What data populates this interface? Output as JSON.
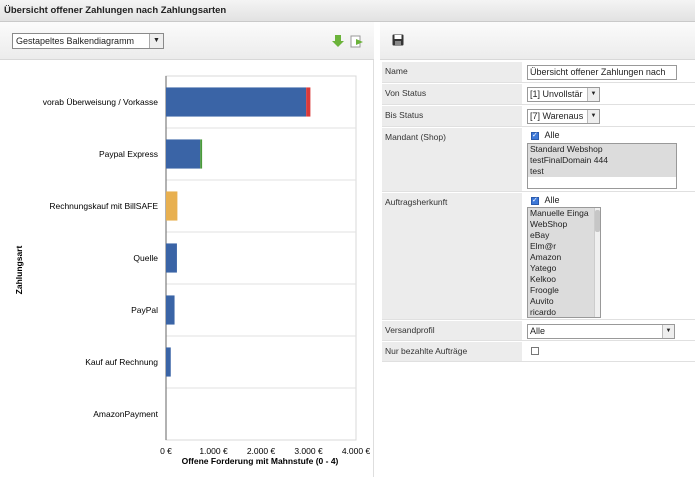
{
  "window": {
    "title": "Übersicht offener Zahlungen nach Zahlungsarten"
  },
  "toolbar": {
    "chart_type_value": "Gestapeltes Balkendiagramm",
    "icons": [
      "download-icon",
      "export-icon",
      "save-icon"
    ]
  },
  "chart_data": {
    "type": "bar",
    "orientation": "horizontal",
    "stacked": true,
    "categories": [
      "vorab Überweisung / Vorkasse",
      "Paypal Express",
      "Rechnungskauf mit BillSAFE",
      "Quelle",
      "PayPal",
      "Kauf auf Rechnung",
      "AmazonPayment"
    ],
    "series": [
      {
        "color": "#3a64a6",
        "values": [
          2950,
          720,
          0,
          230,
          180,
          100,
          0
        ]
      },
      {
        "color": "#4a9a3a",
        "values": [
          0,
          40,
          0,
          0,
          0,
          0,
          0
        ]
      },
      {
        "color": "#e8b050",
        "values": [
          0,
          0,
          240,
          0,
          0,
          0,
          0
        ]
      },
      {
        "color": "#d93a3a",
        "values": [
          90,
          0,
          0,
          0,
          0,
          0,
          0
        ]
      }
    ],
    "xlabel": "Offene Forderung mit Mahnstufe (0 - 4)",
    "ylabel": "Zahlungsart",
    "xlim": [
      0,
      4000
    ],
    "xticks": [
      "0 €",
      "1.000 €",
      "2.000 €",
      "3.000 €",
      "4.000 €"
    ],
    "grid": "horizontal"
  },
  "form": {
    "name": {
      "label": "Name",
      "value": "Übersicht offener Zahlungen nach"
    },
    "von_status": {
      "label": "Von Status",
      "value": "[1] Unvollstär"
    },
    "bis_status": {
      "label": "Bis Status",
      "value": "[7] Warenaus"
    },
    "mandant": {
      "label": "Mandant (Shop)",
      "all_label": "Alle",
      "options": [
        "Standard Webshop",
        "testFinalDomain 444",
        "test"
      ]
    },
    "auftragsherkunft": {
      "label": "Auftragsherkunft",
      "all_label": "Alle",
      "options": [
        "Manuelle Einga",
        "WebShop",
        "eBay",
        "Elm@r",
        "Amazon",
        "Yatego",
        "Kelkoo",
        "Froogle",
        "Auvito",
        "ricardo"
      ]
    },
    "versandprofil": {
      "label": "Versandprofil",
      "value": "Alle"
    },
    "nur_bezahlte": {
      "label": "Nur bezahlte Aufträge"
    }
  }
}
